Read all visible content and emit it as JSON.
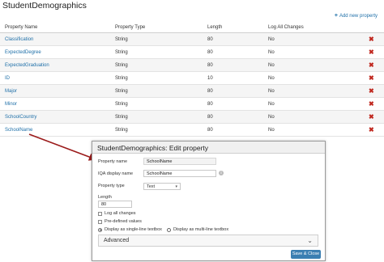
{
  "page": {
    "title": "StudentDemographics",
    "add_link": "Add new property"
  },
  "table": {
    "headers": [
      "Property Name",
      "Property Type",
      "Length",
      "Log All Changes"
    ],
    "rows": [
      [
        "Classification",
        "String",
        "80",
        "No"
      ],
      [
        "ExpectedDegree",
        "String",
        "80",
        "No"
      ],
      [
        "ExpectedGraduation",
        "String",
        "80",
        "No"
      ],
      [
        "ID",
        "String",
        "10",
        "No"
      ],
      [
        "Major",
        "String",
        "80",
        "No"
      ],
      [
        "Minor",
        "String",
        "80",
        "No"
      ],
      [
        "SchoolCountry",
        "String",
        "80",
        "No"
      ],
      [
        "SchoolName",
        "String",
        "80",
        "No"
      ]
    ],
    "delete_icon": "x-delete-icon"
  },
  "dialog": {
    "title": "StudentDemographics: Edit property",
    "property_name_label": "Property name",
    "property_name_value": "SchoolName",
    "iqa_label": "IQA display name",
    "iqa_value": "SchoolName",
    "type_label": "Property type",
    "type_value": "Text",
    "length_label": "Length",
    "length_value": "80",
    "log_all": "Log all changes",
    "predefined": "Pre-defined values",
    "single_line": "Display as single-line textbox",
    "multi_line": "Display as multi-line textbox",
    "advanced": "Advanced",
    "save_close": "Save & Close"
  },
  "colors": {
    "accent": "#1e6fa8",
    "delete": "#c0281f",
    "arrow": "#9b1b1b",
    "button": "#3b7fb2"
  }
}
